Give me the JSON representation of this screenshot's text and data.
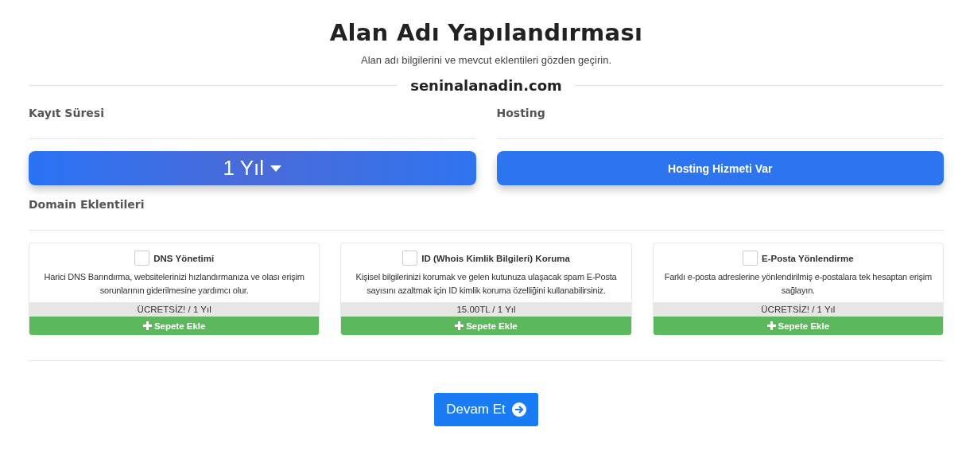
{
  "title": "Alan Adı Yapılandırması",
  "subtitle": "Alan adı bilgilerini ve mevcut eklentileri gözden geçirin.",
  "domain": "seninalanadin.com",
  "registration": {
    "label": "Kayıt Süresi",
    "value": "1 Yıl"
  },
  "hosting": {
    "label": "Hosting",
    "button": "Hosting Hizmeti Var"
  },
  "addons_title": "Domain Eklentileri",
  "addons": [
    {
      "name": "DNS Yönetimi",
      "checked": false,
      "description": "Harici DNS Barındırma, websitelerinizi hızlandırmanıza ve olası erişim sorunlarının giderilmesine yardımcı olur.",
      "price": "ÜCRETSİZ! / 1 Yıl",
      "button": "Sepete Ekle"
    },
    {
      "name": "ID (Whois Kimlik Bilgileri) Koruma",
      "checked": false,
      "description": "Kişisel bilgilerinizi korumak ve gelen kutunuza ulaşacak spam E-Posta sayısını azaltmak için ID kimlik koruma özelliğini kullanabilirsiniz.",
      "price": "15.00TL / 1 Yıl",
      "button": "Sepete Ekle"
    },
    {
      "name": "E-Posta Yönlendirme",
      "checked": false,
      "description": "Farklı e-posta adreslerine yönlendirilmiş e-postalara tek hesaptan erişim sağlayın.",
      "price": "ÜCRETSİZ! / 1 Yıl",
      "button": "Sepete Ekle"
    }
  ],
  "continue_button": "Devam Et"
}
